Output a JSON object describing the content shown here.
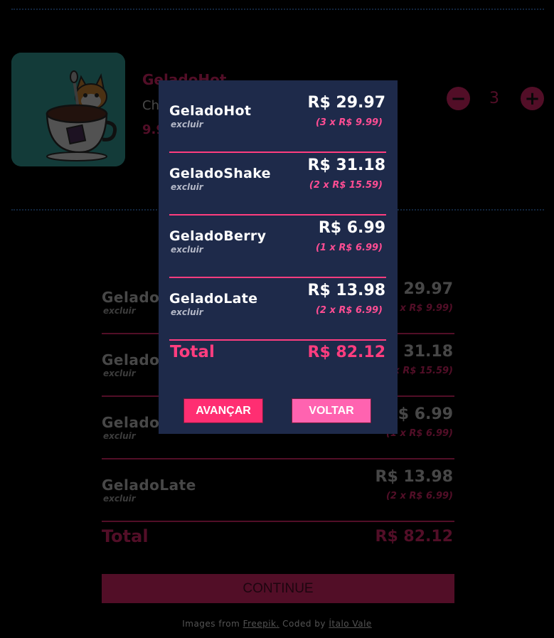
{
  "background": {
    "product": {
      "name": "GeladoHot",
      "description_prefix": "Ch",
      "price_prefix": "9.9"
    },
    "quantity": "3",
    "quantity_minus": "−",
    "quantity_plus": "+",
    "items": [
      {
        "name": "GeladoHot",
        "remove": "excluir",
        "price": "R$ 29.97",
        "detail": "(3 x R$ 9.99)"
      },
      {
        "name": "GeladoShake",
        "remove": "excluir",
        "price": "R$ 31.18",
        "detail": "(2 x R$ 15.59)"
      },
      {
        "name": "GeladoBerry",
        "remove": "excluir",
        "price": "R$ 6.99",
        "detail": "(1 x R$ 6.99)"
      },
      {
        "name": "GeladoLate",
        "remove": "excluir",
        "price": "R$ 13.98",
        "detail": "(2 x R$ 6.99)"
      }
    ],
    "total_label": "Total",
    "total_value": "R$ 82.12",
    "continue_label": "CONTINUE",
    "footer": {
      "prefix": "Images from",
      "freepik": "Freepik.",
      "coded_by": "Coded by",
      "author": "Ítalo Vale"
    }
  },
  "modal": {
    "items": [
      {
        "name": "GeladoHot",
        "remove": "excluir",
        "price": "R$ 29.97",
        "detail": "(3 x R$ 9.99)"
      },
      {
        "name": "GeladoShake",
        "remove": "excluir",
        "price": "R$ 31.18",
        "detail": "(2 x R$ 15.59)"
      },
      {
        "name": "GeladoBerry",
        "remove": "excluir",
        "price": "R$ 6.99",
        "detail": "(1 x R$ 6.99)"
      },
      {
        "name": "GeladoLate",
        "remove": "excluir",
        "price": "R$ 13.98",
        "detail": "(2 x R$ 6.99)"
      }
    ],
    "total_label": "Total",
    "total_value": "R$ 82.12",
    "advance_label": "AVANÇAR",
    "back_label": "VOLTAR"
  },
  "colors": {
    "accent": "#ff2e7a",
    "modal_bg": "#1e2a4a",
    "back_button": "#ff63b0",
    "background": "#000000"
  },
  "icons": {
    "product_image": "cat-in-coffee-cup-illustration",
    "minus": "minus-icon",
    "plus": "plus-icon"
  }
}
